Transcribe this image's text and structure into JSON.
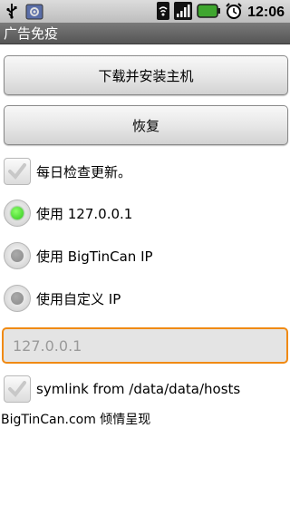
{
  "status_bar": {
    "time": "12:06",
    "icons": [
      "usb-icon",
      "debug-icon",
      "wifi-icon",
      "signal-icon",
      "battery-icon",
      "alarm-icon"
    ]
  },
  "title_bar": {
    "title": "广告免疫"
  },
  "buttons": {
    "install_label": "下载并安装主机",
    "restore_label": "恢复"
  },
  "options": {
    "daily_check_label": "每日检查更新。",
    "daily_check_checked": false,
    "radio_localhost_label": "使用 127.0.0.1",
    "radio_bigtincan_label": "使用 BigTinCan IP",
    "radio_custom_label": "使用自定义 IP",
    "selected_radio": "localhost"
  },
  "custom_ip_input": {
    "placeholder": "127.0.0.1",
    "value": ""
  },
  "symlink": {
    "label": "symlink from /data/data/hosts",
    "checked": false
  },
  "footer": {
    "text": "BigTinCan.com 倾情呈现"
  },
  "colors": {
    "title_bar": "#555555",
    "input_focus_border": "#f08a13",
    "radio_selected": "#2fc81a"
  }
}
